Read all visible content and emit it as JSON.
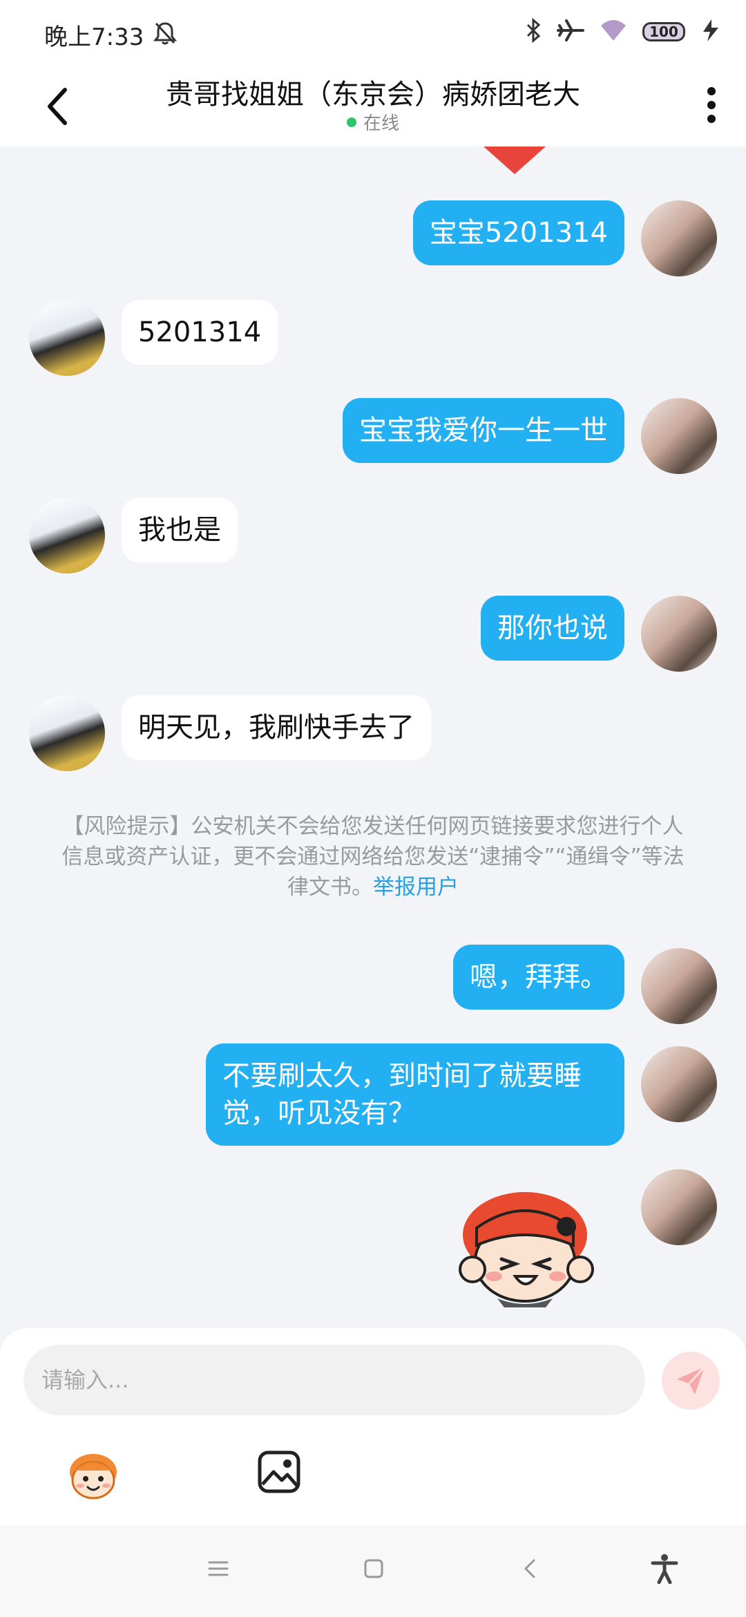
{
  "status_bar": {
    "time": "晚上7:33",
    "battery": "100"
  },
  "header": {
    "title": "贵哥找姐姐（东京会）病娇团老大",
    "status": "在线"
  },
  "messages": [
    {
      "side": "out",
      "text": "宝宝5201314"
    },
    {
      "side": "in",
      "text": "5201314"
    },
    {
      "side": "out",
      "text": "宝宝我爱你一生一世"
    },
    {
      "side": "in",
      "text": "我也是"
    },
    {
      "side": "out",
      "text": "那你也说"
    },
    {
      "side": "in",
      "text": "明天见，我刷快手去了"
    },
    {
      "side": "out",
      "text": "嗯，拜拜。"
    },
    {
      "side": "out",
      "text": "不要刷太久，到时间了就要睡\n觉，听见没有？"
    }
  ],
  "notice": {
    "text": "【风险提示】公安机关不会给您发送任何网页链接要求您进行个人信息或资产认证，更不会通过网络给您发送“逮捕令”“通缉令”等法律文书。",
    "link": "举报用户"
  },
  "input": {
    "placeholder": "请输入..."
  },
  "colors": {
    "outgoing_bubble": "#22b0f2",
    "incoming_bubble": "#ffffff",
    "background": "#f2f4f8",
    "online_dot": "#2cc56a",
    "link": "#2a9fe0"
  },
  "icons": {
    "back": "chevron-left-icon",
    "more": "more-vertical-icon",
    "send": "send-icon",
    "emoji": "emoji-icon",
    "image": "image-icon"
  }
}
